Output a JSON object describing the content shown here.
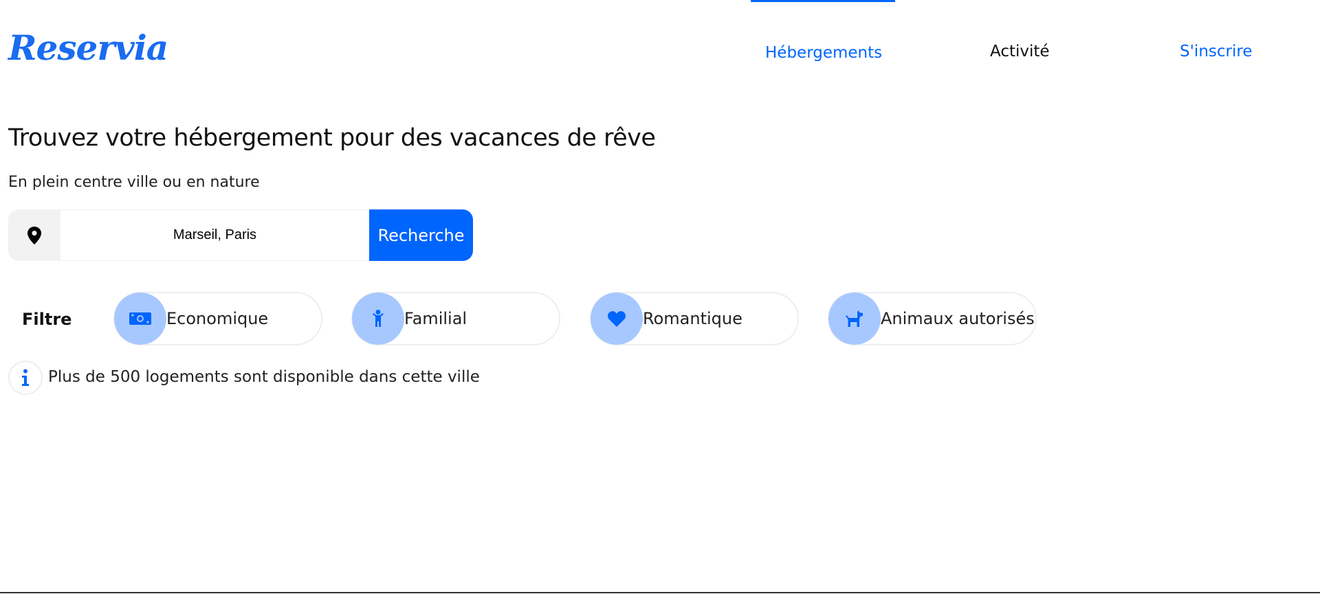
{
  "header": {
    "logo": "Reservia",
    "nav": [
      {
        "label": "Hébergements",
        "active": true
      },
      {
        "label": "Activité",
        "active": false
      },
      {
        "label": "S'inscrire",
        "active": false
      }
    ]
  },
  "hero": {
    "title": "Trouvez votre hébergement pour des vacances de rêve",
    "subtitle": "En plein centre ville ou en nature"
  },
  "search": {
    "icon": "location-pin-icon",
    "value": "Marseil, Paris",
    "button_label": "Recherche"
  },
  "filters": {
    "label": "Filtre",
    "items": [
      {
        "label": "Economique",
        "icon": "money-icon"
      },
      {
        "label": "Familial",
        "icon": "child-icon"
      },
      {
        "label": "Romantique",
        "icon": "heart-icon"
      },
      {
        "label": "Animaux autorisés",
        "icon": "dog-icon"
      }
    ]
  },
  "info": {
    "icon": "info-icon",
    "text": "Plus de 500 logements sont disponible dans cette ville"
  },
  "colors": {
    "primary": "#0065fc",
    "chip_icon_bg": "#a7c8ff",
    "input_icon_bg": "#f2f2f2"
  }
}
